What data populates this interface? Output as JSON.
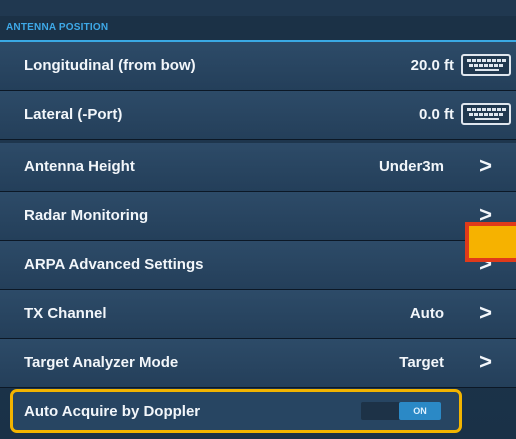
{
  "section": {
    "title": "ANTENNA POSITION"
  },
  "rows": [
    {
      "label": "Longitudinal (from bow)",
      "value": "20.0 ft",
      "control": "keyboard-icon"
    },
    {
      "label": "Lateral (-Port)",
      "value": "0.0 ft",
      "control": "keyboard-icon"
    },
    {
      "label": "Antenna Height",
      "value": "Under3m",
      "control": "chevron-right-icon"
    },
    {
      "label": "Radar Monitoring",
      "value": "",
      "control": "chevron-right-icon"
    },
    {
      "label": "ARPA Advanced Settings",
      "value": "",
      "control": "chevron-right-icon"
    },
    {
      "label": "TX Channel",
      "value": "Auto",
      "control": "chevron-right-icon"
    },
    {
      "label": "Target Analyzer Mode",
      "value": "Target",
      "control": "chevron-right-icon"
    }
  ],
  "doppler": {
    "label": "Auto Acquire by Doppler",
    "toggle_state": "ON"
  },
  "icons": {
    "chevron": ">"
  },
  "colors": {
    "accent": "#3aa9e4",
    "highlight": "#f2b400",
    "marker_fill": "#f6b200",
    "marker_border": "#e03a1a"
  }
}
